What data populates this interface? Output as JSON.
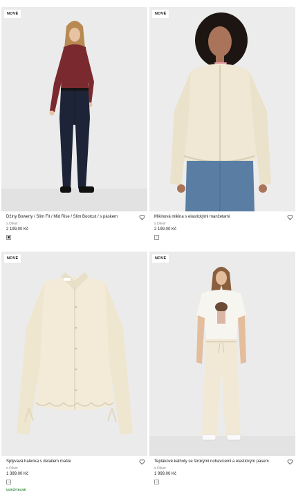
{
  "products": [
    {
      "badge": "NOVÉ",
      "title": "Džíny Bowerly / Slim Fit / Mid Rise / Slim Bootcut / s páskem",
      "brand": "s.Oliver",
      "price": "2 199,00 Kč",
      "swatch_color": "#1c1f2b",
      "sustainability": ""
    },
    {
      "badge": "NOVÉ",
      "title": "Mikinová mikina s elastickými manžetami",
      "brand": "s.Oliver",
      "price": "2 199,00 Kč",
      "swatch_color": "#f1ead8",
      "sustainability": ""
    },
    {
      "badge": "NOVÉ",
      "title": "Splývavá halenka s detailem mašle",
      "brand": "s.Oliver",
      "price": "1 399,00 Kč",
      "swatch_color": "#f1ead8",
      "sustainability": "UDRŽITELNÉ"
    },
    {
      "badge": "NOVÉ",
      "title": "Teplákové kalhoty se širokými nohavicemi a elastickým pasem",
      "brand": "s.Oliver",
      "price": "1 999,00 Kč",
      "swatch_color": "#f1ead8",
      "sustainability": ""
    }
  ],
  "icons": {
    "wishlist": "heart-outline-icon"
  },
  "colors": {
    "photo_bg": "#e9e9e9",
    "sustain_green": "#2e8b3a"
  }
}
